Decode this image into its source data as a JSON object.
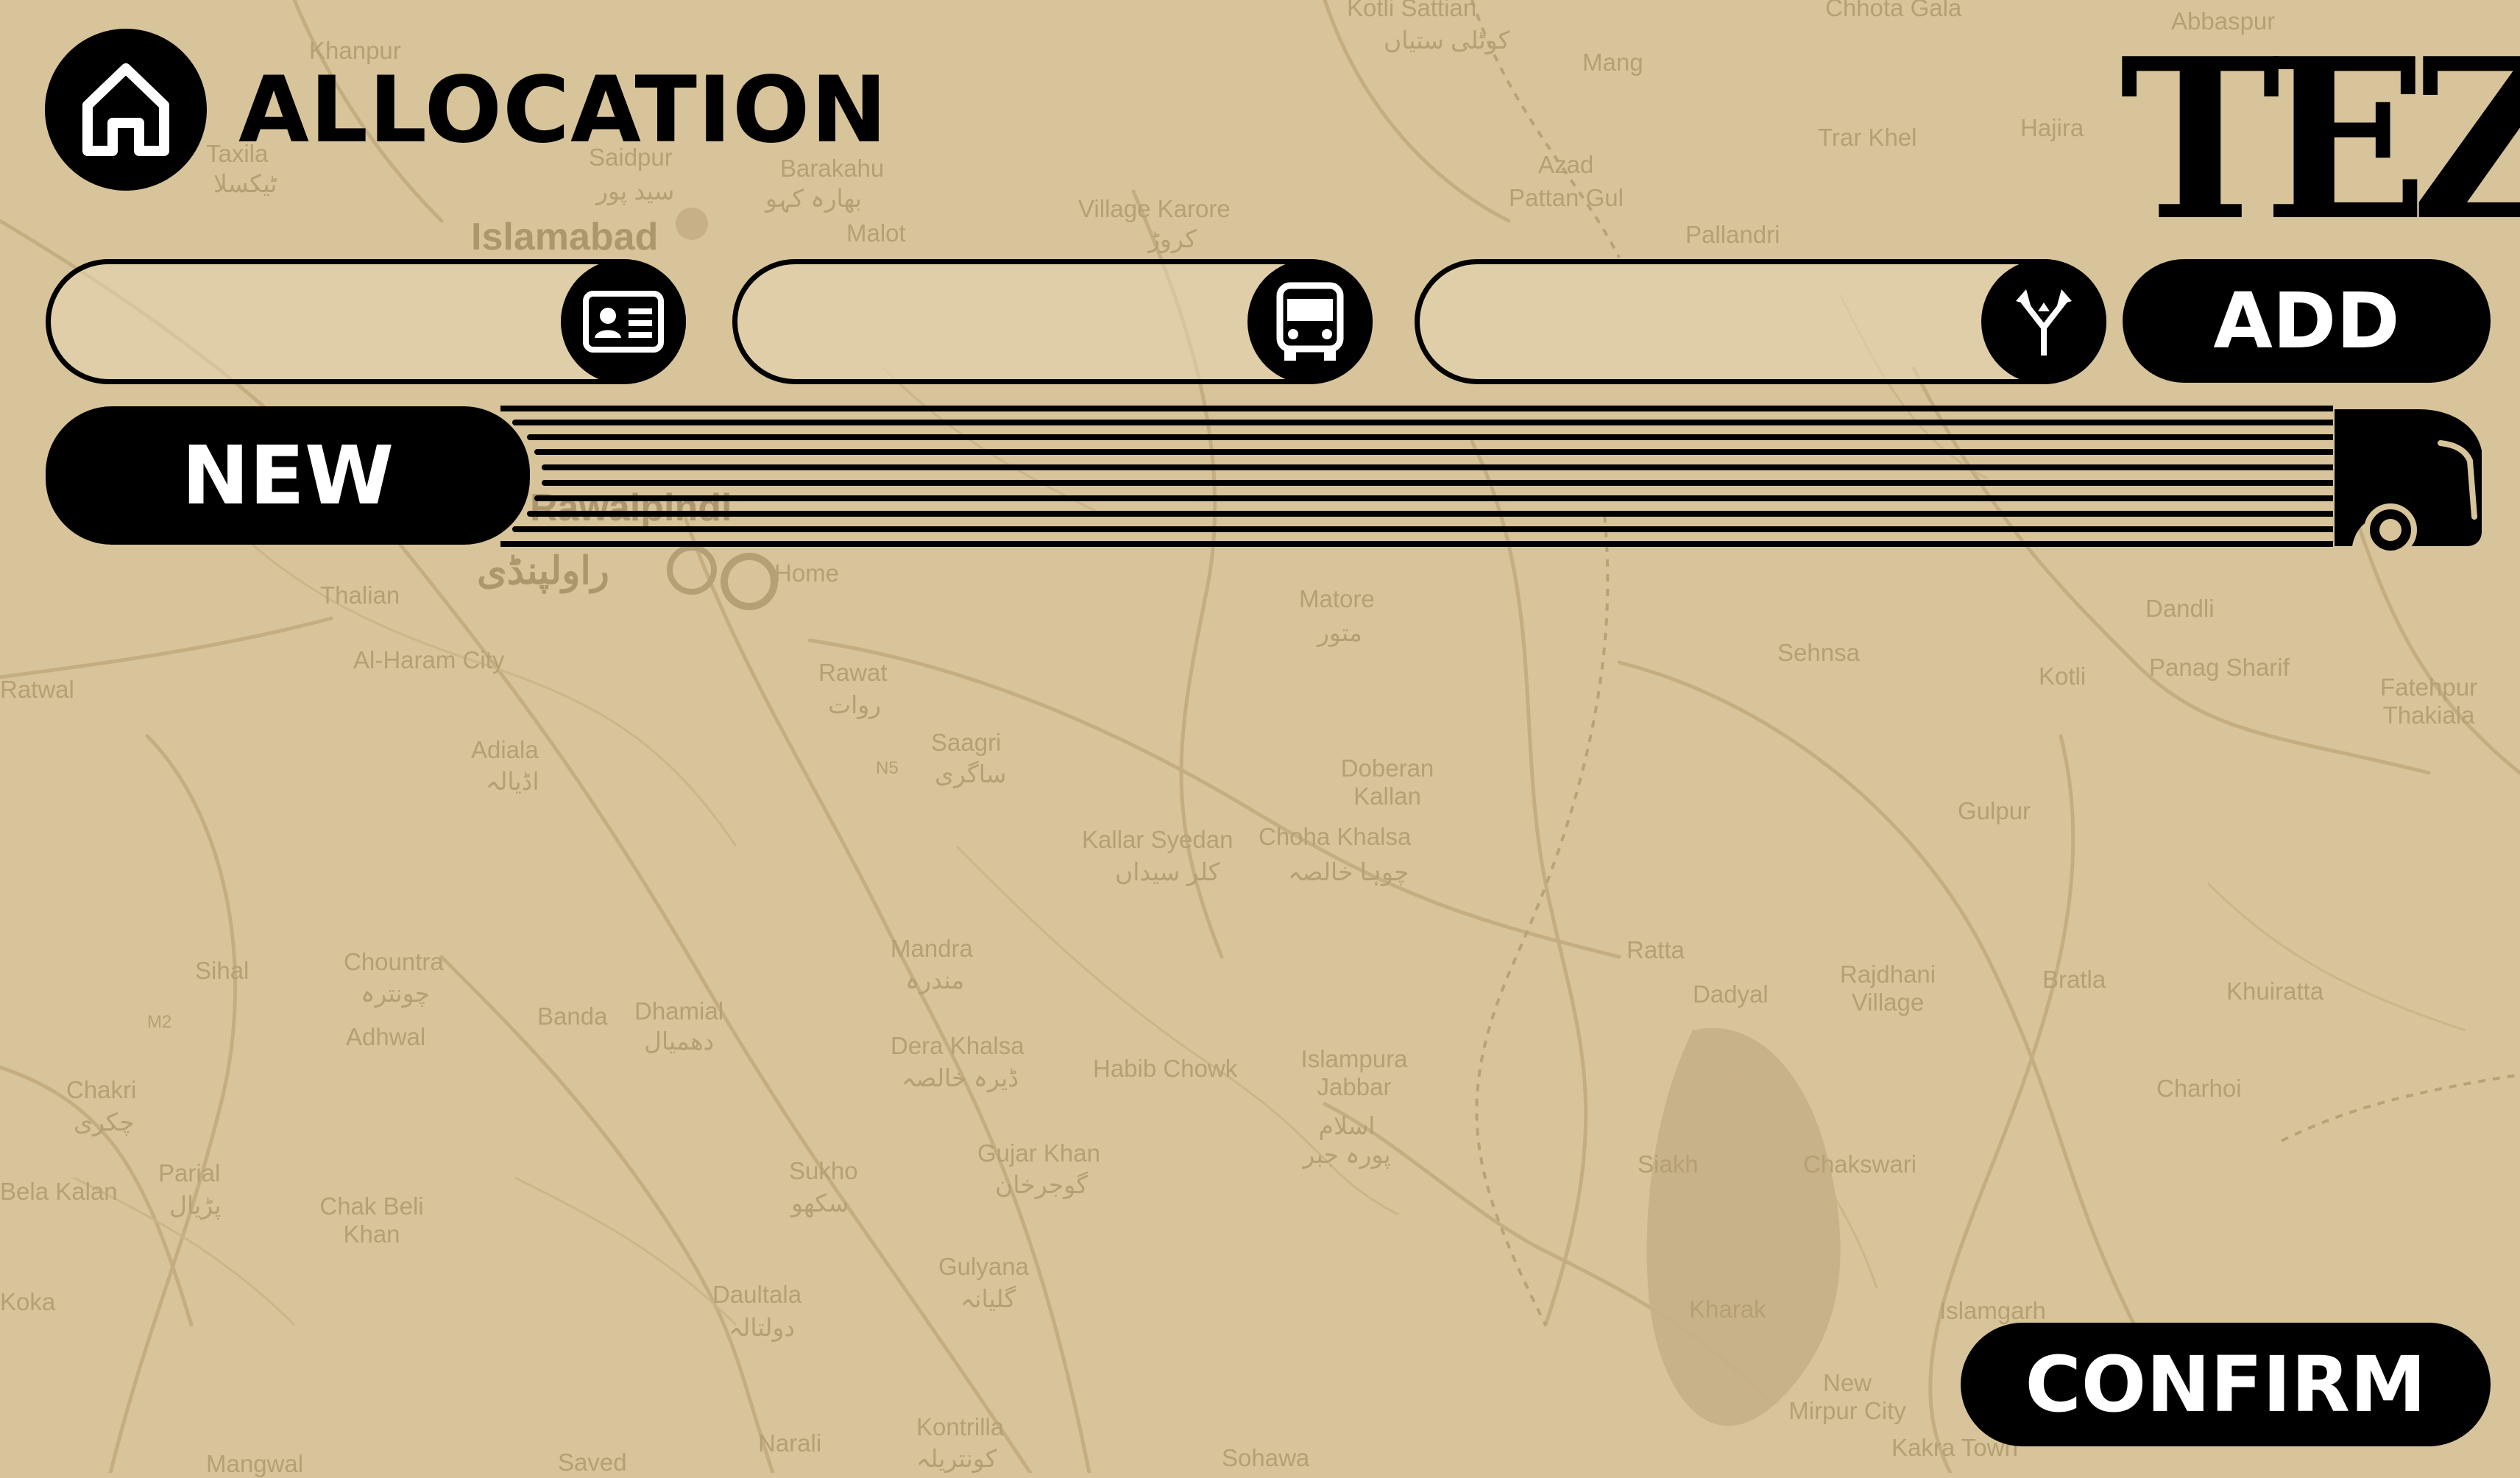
{
  "header": {
    "title": "ALLOCATION",
    "logo": "TEZ",
    "home_icon": "home-icon"
  },
  "inputs": [
    {
      "name": "id-card-field",
      "value": "",
      "icon": "id-card-icon"
    },
    {
      "name": "bus-field",
      "value": "",
      "icon": "bus-icon"
    },
    {
      "name": "route-field",
      "value": "",
      "icon": "route-merge-icon"
    }
  ],
  "buttons": {
    "add": "ADD",
    "new": "NEW",
    "confirm": "CONFIRM"
  },
  "progress_graphic": {
    "icon": "truck-icon"
  },
  "map": {
    "labels": [
      "Khanpur",
      "Taxila",
      "ٹیکسلا",
      "Saidpur",
      "سید پور",
      "Barakahu",
      "بھارہ کہو",
      "Islamabad",
      "Malot",
      "Village Karore",
      "کروڑ",
      "Kotli Sattian",
      "کوٹلی ستیاں",
      "Mang",
      "Azad",
      "Pattan Gul",
      "Pallandri",
      "Chhota Gala",
      "Abbaspur",
      "Hajira",
      "Trar Khel",
      "Rawalpindi",
      "راولپنڈی",
      "Home",
      "Thalian",
      "Al-Haram City",
      "Ratwal",
      "Rawat",
      "روات",
      "Adiala",
      "اڈیالہ",
      "Saagri",
      "ساگری",
      "Matore",
      "متور",
      "Doberan Kallan",
      "Kallar Syedan",
      "کلر سیداں",
      "Choha Khalsa",
      "چوہا خالصہ",
      "Sehnsa",
      "Kotli",
      "Dandli",
      "Panag Sharif",
      "Fatehpur Thakiala",
      "Gulpur",
      "Sihal",
      "Chountra",
      "چونترہ",
      "Adhwal",
      "Banda",
      "Dhamial",
      "دھمیال",
      "Mandra",
      "مندرہ",
      "Dera Khalsa",
      "ڈیرہ خالصہ",
      "Habib Chowk",
      "Islampura Jabbar",
      "اسلام پورہ جبر",
      "Ratta",
      "Dadyal",
      "Rajdhani Village",
      "Bratla",
      "Khuiratta",
      "Charhoi",
      "Chakri",
      "چکری",
      "Parial",
      "پڑیال",
      "Chak Beli Khan",
      "Sukho",
      "سکھو",
      "Gujar Khan",
      "گوجرخان",
      "Siakh",
      "Chakswari",
      "Daultala",
      "دولتالہ",
      "Gulyana",
      "گلیانہ",
      "Kharak",
      "Islamgarh",
      "New Mirpur City",
      "Koka",
      "Narali",
      "Kontrilla",
      "کونتریلہ",
      "Sohawa",
      "Mangwal",
      "Saved",
      "Kakra Town",
      "Bela Kalan",
      "N5",
      "M2"
    ]
  },
  "colors": {
    "background": "#d8c49a",
    "map_lines": "#c2ab7e",
    "map_text": "#b59f74",
    "ink": "#000000",
    "button_text": "#ffffff"
  }
}
